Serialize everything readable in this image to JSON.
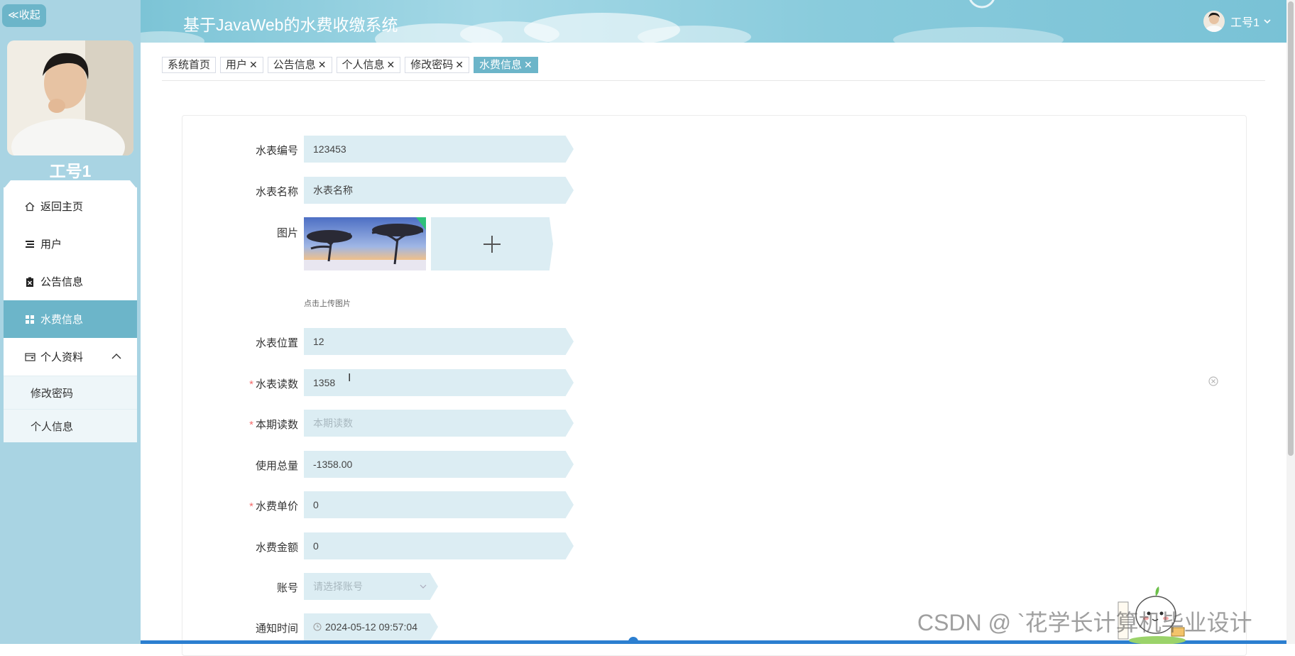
{
  "sidebar": {
    "collapse_label": "≪收起",
    "user_name": "工号1",
    "menu": [
      {
        "label": "返回主页",
        "icon": "home-icon"
      },
      {
        "label": "用户",
        "icon": "list-icon"
      },
      {
        "label": "公告信息",
        "icon": "clipboard-icon"
      },
      {
        "label": "水费信息",
        "icon": "grid-icon",
        "active": true
      },
      {
        "label": "个人资料",
        "icon": "wallet-icon",
        "expanded": true
      }
    ],
    "submenu": [
      {
        "label": "修改密码"
      },
      {
        "label": "个人信息"
      }
    ]
  },
  "header": {
    "title": "基于JavaWeb的水费收缴系统",
    "user_label": "工号1"
  },
  "tabs": [
    {
      "label": "系统首页",
      "closable": false
    },
    {
      "label": "用户",
      "closable": true
    },
    {
      "label": "公告信息",
      "closable": true
    },
    {
      "label": "个人信息",
      "closable": true
    },
    {
      "label": "修改密码",
      "closable": true
    },
    {
      "label": "水费信息",
      "closable": true,
      "active": true
    }
  ],
  "form": {
    "meter_no": {
      "label": "水表编号",
      "value": "123453"
    },
    "meter_name": {
      "label": "水表名称",
      "value": "水表名称"
    },
    "image": {
      "label": "图片",
      "upload_tip": "点击上传图片"
    },
    "meter_location": {
      "label": "水表位置",
      "value": "12"
    },
    "meter_reading": {
      "label": "水表读数",
      "value": "1358",
      "required": true
    },
    "current_reading": {
      "label": "本期读数",
      "placeholder": "本期读数",
      "required": true
    },
    "total_usage": {
      "label": "使用总量",
      "value": "-1358.00"
    },
    "unit_price": {
      "label": "水费单价",
      "value": "0",
      "required": true
    },
    "amount": {
      "label": "水费金额",
      "value": "0"
    },
    "account": {
      "label": "账号",
      "placeholder": "请选择账号"
    },
    "notify_time": {
      "label": "通知时间",
      "value": "2024-05-12 09:57:04"
    }
  },
  "watermark": "CSDN @ `花学长计算机毕业设计",
  "colors": {
    "sidebar_bg": "#a9d4e3",
    "accent": "#6cb5c9",
    "field_bg": "#dcedf3",
    "required": "#f56c6c"
  }
}
